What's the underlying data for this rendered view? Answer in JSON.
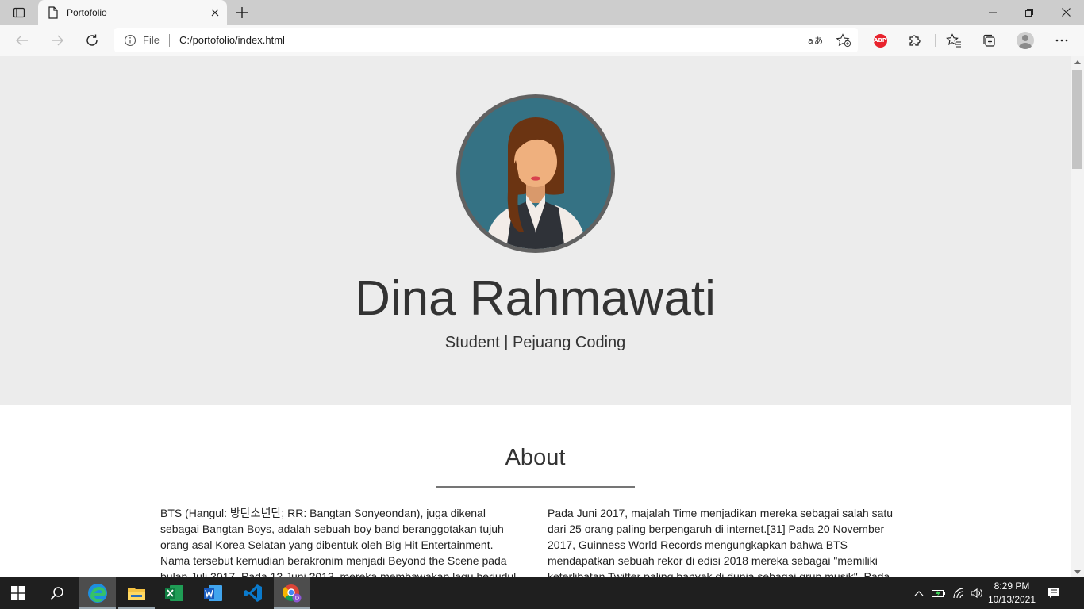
{
  "browser": {
    "tab_title": "Portofolio",
    "omnibox": {
      "file_label": "File",
      "url": "C:/portofolio/index.html"
    },
    "abp_label": "ABP"
  },
  "page": {
    "hero": {
      "name": "Dina Rahmawati",
      "tagline": "Student | Pejuang Coding"
    },
    "about": {
      "title": "About",
      "left_text": "BTS (Hangul: 방탄소년단; RR: Bangtan Sonyeondan), juga dikenal sebagai Bangtan Boys, adalah sebuah boy band beranggotakan tujuh orang asal Korea Selatan yang dibentuk oleh Big Hit Entertainment. Nama tersebut kemudian berakronim menjadi Beyond the Scene pada bulan Juli 2017. Pada 12 Juni 2013, mereka membawakan lagu berjudul",
      "right_text": "Pada Juni 2017, majalah Time menjadikan mereka sebagai salah satu dari 25 orang paling berpengaruh di internet.[31] Pada 20 November 2017, Guinness World Records mengungkapkan bahwa BTS mendapatkan sebuah rekor di edisi 2018 mereka sebagai \"memiliki keterlibatan Twitter paling banyak di dunia sebagai grup musik\". Pada"
    }
  },
  "taskbar": {
    "clock_time": "8:29 PM",
    "clock_date": "10/13/2021"
  },
  "colors": {
    "hero_bg": "#ececec",
    "avatar_bg": "#357284",
    "avatar_border": "#616161",
    "taskbar_bg": "#1f1f1f"
  }
}
